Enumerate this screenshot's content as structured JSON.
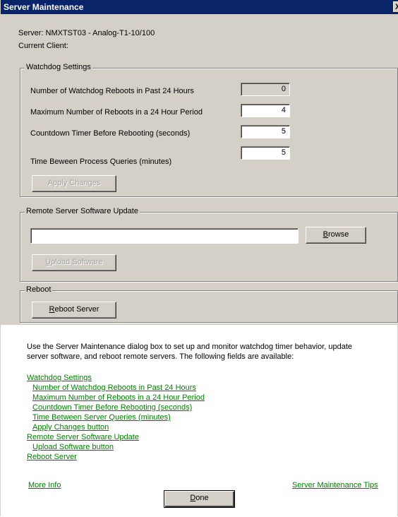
{
  "window": {
    "title": "Server Maintenance",
    "close_glyph": "X"
  },
  "server_line": "Server:  NMXTST03 - Analog-T1-10/100",
  "client_line": "Current Client:",
  "watchdog": {
    "legend": "Watchdog Settings",
    "rows": [
      {
        "label": "Number of Watchdog Reboots in Past 24 Hours",
        "value": "0",
        "readonly": true
      },
      {
        "label": "Maximum Number of Reboots in a 24 Hour Period",
        "value": "4"
      },
      {
        "label": "Countdown Timer Before Rebooting (seconds)",
        "value": "5"
      },
      {
        "label": "Time Beween Process Queries (minutes)",
        "value": "5"
      }
    ],
    "apply_label": "Apply Changes"
  },
  "update": {
    "legend": "Remote Server Software Update",
    "path_value": "",
    "browse_mnemonic": "B",
    "browse_rest": "rowse",
    "upload_mnemonic": "U",
    "upload_rest": "pload Software"
  },
  "reboot": {
    "legend": "Reboot",
    "button_mnemonic": "R",
    "button_rest": "eboot Server"
  },
  "help": {
    "intro_line1": "Use the Server Maintenance dialog box to set up and monitor watchdog timer behavior, update",
    "intro_line2": "server software, and reboot remote servers. The following fields are available:",
    "links": [
      "Watchdog Settings",
      "Number of Watchdog Reboots in Past 24 Hours",
      "Maximum Number of Reboots in a 24 Hour Period",
      "Countdown Timer Before Rebooting (seconds)",
      "Time Between Server Queries (minutes)",
      "Apply Changes button",
      "Remote Server Software Update",
      "Upload Software button",
      "Reboot Server"
    ],
    "more_info": "More Info",
    "tips": "Server Maintenance Tips"
  },
  "done": {
    "mnemonic": "D",
    "rest": "one"
  },
  "colors": {
    "link": "#008000",
    "titlebar": "#0a246a",
    "dialog": "#d4d0c8"
  }
}
